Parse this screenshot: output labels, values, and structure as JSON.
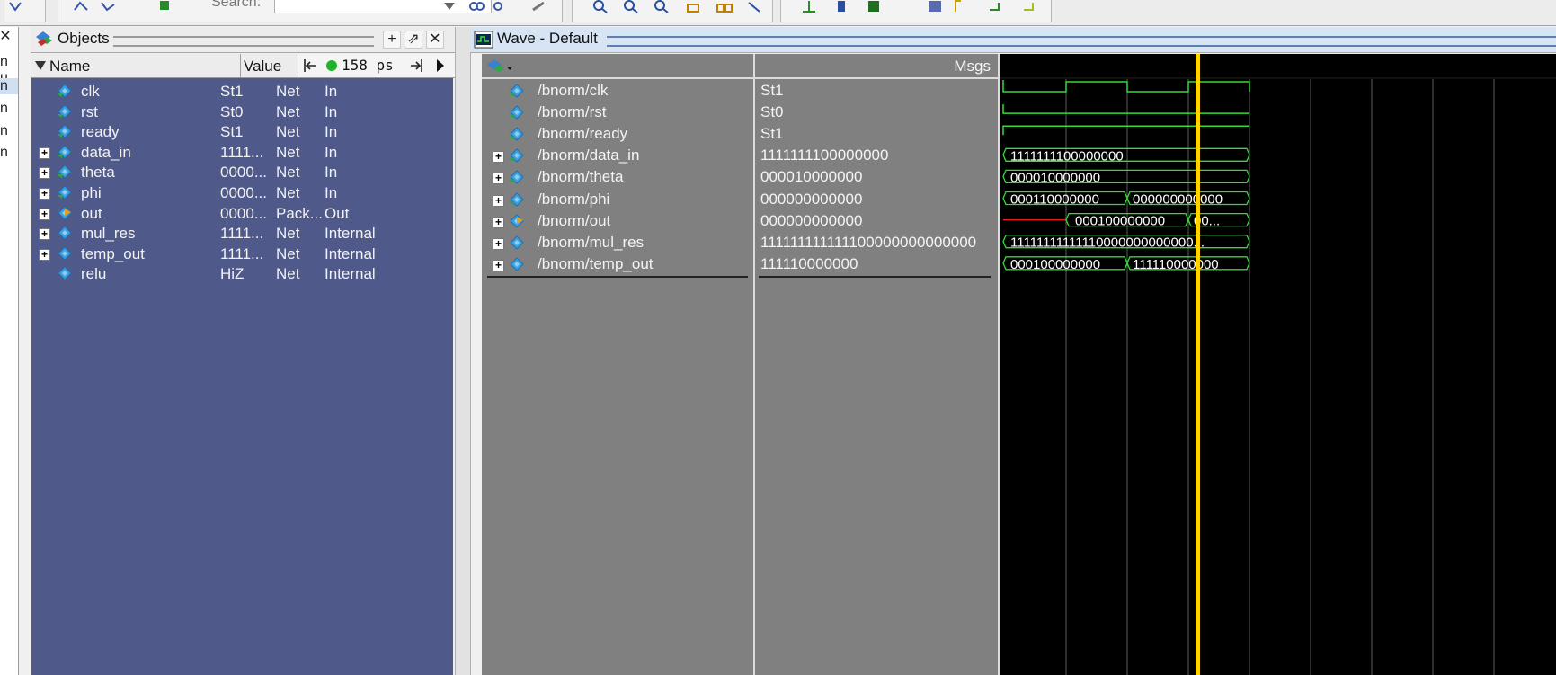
{
  "toolbar": {
    "search_label": "Search:"
  },
  "left_pane": {
    "lines": [
      "n u",
      "n",
      "n",
      "n",
      "n"
    ]
  },
  "objects": {
    "title": "Objects",
    "headers": {
      "name": "Name",
      "value": "Value"
    },
    "time_display": "158 ps",
    "rows": [
      {
        "name": "clk",
        "value": "St1",
        "kind": "Net",
        "mode": "In",
        "expandable": false,
        "icon": "input-port-icon"
      },
      {
        "name": "rst",
        "value": "St0",
        "kind": "Net",
        "mode": "In",
        "expandable": false,
        "icon": "input-port-icon"
      },
      {
        "name": "ready",
        "value": "St1",
        "kind": "Net",
        "mode": "In",
        "expandable": false,
        "icon": "input-port-icon"
      },
      {
        "name": "data_in",
        "value": "1111...",
        "kind": "Net",
        "mode": "In",
        "expandable": true,
        "icon": "input-port-icon"
      },
      {
        "name": "theta",
        "value": "0000...",
        "kind": "Net",
        "mode": "In",
        "expandable": true,
        "icon": "input-port-icon"
      },
      {
        "name": "phi",
        "value": "0000...",
        "kind": "Net",
        "mode": "In",
        "expandable": true,
        "icon": "input-port-icon"
      },
      {
        "name": "out",
        "value": "0000...",
        "kind": "Pack...",
        "mode": "Out",
        "expandable": true,
        "icon": "output-port-icon"
      },
      {
        "name": "mul_res",
        "value": "1111...",
        "kind": "Net",
        "mode": "Internal",
        "expandable": true,
        "icon": "internal-signal-icon"
      },
      {
        "name": "temp_out",
        "value": "1111...",
        "kind": "Net",
        "mode": "Internal",
        "expandable": true,
        "icon": "internal-signal-icon"
      },
      {
        "name": "relu",
        "value": "HiZ",
        "kind": "Net",
        "mode": "Internal",
        "expandable": false,
        "icon": "internal-signal-icon"
      }
    ]
  },
  "wave": {
    "title": "Wave - Default",
    "msgs_label": "Msgs",
    "signals": [
      {
        "path": "/bnorm/clk",
        "value": "St1",
        "expandable": false,
        "icon": "input-port-icon"
      },
      {
        "path": "/bnorm/rst",
        "value": "St0",
        "expandable": false,
        "icon": "input-port-icon"
      },
      {
        "path": "/bnorm/ready",
        "value": "St1",
        "expandable": false,
        "icon": "input-port-icon"
      },
      {
        "path": "/bnorm/data_in",
        "value": "1111111100000000",
        "expandable": true,
        "icon": "input-port-icon"
      },
      {
        "path": "/bnorm/theta",
        "value": "000010000000",
        "expandable": true,
        "icon": "input-port-icon"
      },
      {
        "path": "/bnorm/phi",
        "value": "000000000000",
        "expandable": true,
        "icon": "input-port-icon"
      },
      {
        "path": "/bnorm/out",
        "value": "000000000000",
        "expandable": true,
        "icon": "output-port-icon"
      },
      {
        "path": "/bnorm/mul_res",
        "value": "111111111111100000000000000",
        "expandable": true,
        "icon": "internal-signal-icon"
      },
      {
        "path": "/bnorm/temp_out",
        "value": "111110000000",
        "expandable": true,
        "icon": "internal-signal-icon"
      }
    ],
    "bus_labels": {
      "data_in": [
        "1111111100000000"
      ],
      "theta": [
        "000010000000"
      ],
      "phi": [
        "000110000000",
        "000000000000"
      ],
      "out": [
        "000100000000",
        "00..."
      ],
      "mul_res": [
        "11111111111110000000000000..."
      ],
      "temp_out": [
        "000100000000",
        "111110000000"
      ]
    },
    "colors": {
      "wave": "#33dd33",
      "cursor": "#ffd400",
      "x_state": "#e02020",
      "grid": "#5a5a5a",
      "panel_bg": "#505a8a"
    }
  }
}
